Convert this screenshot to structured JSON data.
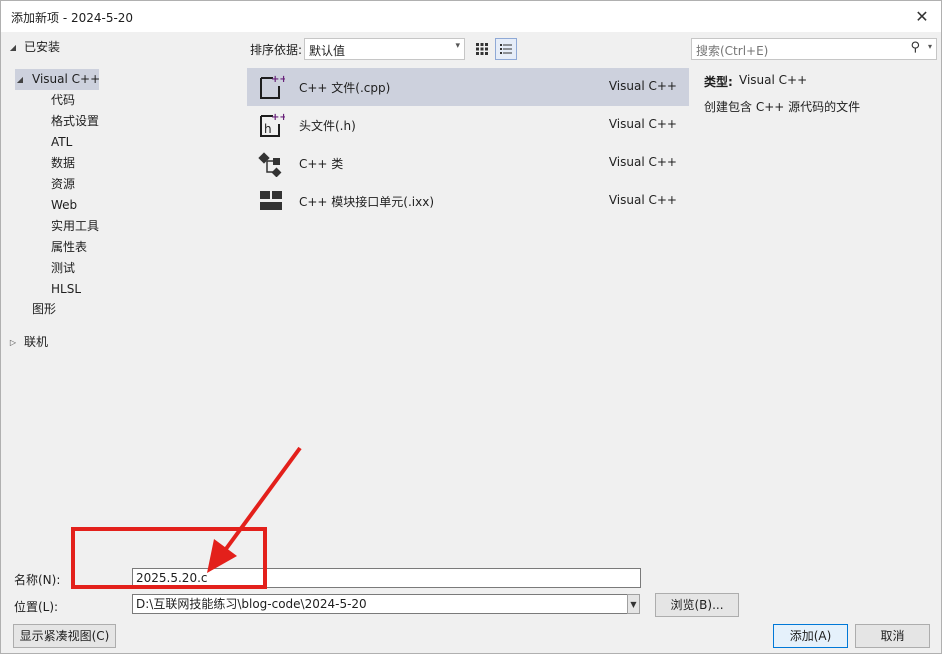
{
  "window": {
    "title": "添加新项 - 2024-5-20",
    "close_glyph": "✕"
  },
  "tree": {
    "installed": "已安装",
    "visual_cpp": "Visual C++",
    "children": [
      "代码",
      "格式设置",
      "ATL",
      "数据",
      "资源",
      "Web",
      "实用工具",
      "属性表",
      "测试",
      "HLSL"
    ],
    "graphics": "图形",
    "online": "联机"
  },
  "toolbar": {
    "sort_label": "排序依据:",
    "sort_value": "默认值"
  },
  "templates": [
    {
      "name": "C++ 文件(.cpp)",
      "lang": "Visual C++",
      "icon": "cpp-file-icon"
    },
    {
      "name": "头文件(.h)",
      "lang": "Visual C++",
      "icon": "header-file-icon"
    },
    {
      "name": "C++ 类",
      "lang": "Visual C++",
      "icon": "class-icon"
    },
    {
      "name": "C++ 模块接口单元(.ixx)",
      "lang": "Visual C++",
      "icon": "module-icon"
    }
  ],
  "details": {
    "search_placeholder": "搜索(Ctrl+E)",
    "type_label": "类型:",
    "type_value": "Visual C++",
    "description": "创建包含 C++ 源代码的文件"
  },
  "form": {
    "name_label": "名称(N):",
    "name_value": "2025.5.20.c",
    "location_label": "位置(L):",
    "location_value": "D:\\互联网技能练习\\blog-code\\2024-5-20",
    "browse_label": "浏览(B)...",
    "compact_view_label": "显示紧凑视图(C)",
    "add_label": "添加(A)",
    "cancel_label": "取消"
  },
  "colors": {
    "selection": "#cdd1dd",
    "annotation": "#e3201b",
    "icon_purple": "#68217a"
  }
}
